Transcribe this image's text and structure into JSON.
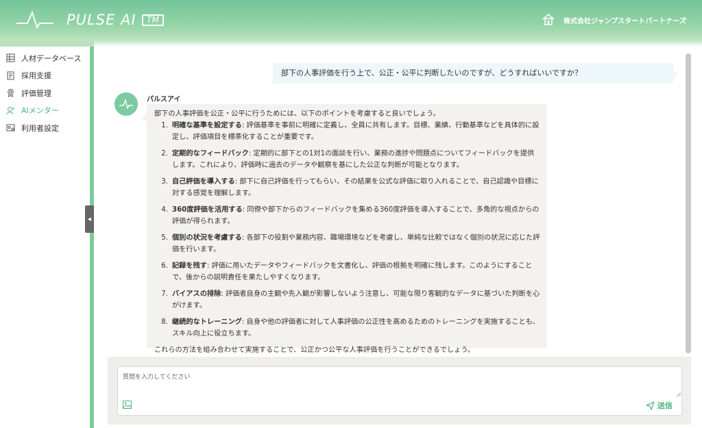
{
  "header": {
    "brand": "PULSE AI",
    "tm": "TM",
    "company": "株式会社ジャンプスタートパートナーズ",
    "chevron": "⌄"
  },
  "sidebar": {
    "items": [
      {
        "label": "人材データベース",
        "icon": "database-icon"
      },
      {
        "label": "採用支援",
        "icon": "document-icon"
      },
      {
        "label": "評価管理",
        "icon": "award-icon"
      },
      {
        "label": "AIメンター",
        "icon": "mentor-icon",
        "active": true
      },
      {
        "label": "利用者設定",
        "icon": "user-settings-icon"
      }
    ],
    "collapse_label": "◀"
  },
  "chat": {
    "user_message": "部下の人事評価を行う上で、公正・公平に判断したいのですが、どうすればいいですか？",
    "bot_name": "パルスアイ",
    "bot_intro": "部下の人事評価を公正・公平に行うためには、以下のポイントを考慮すると良いでしょう。",
    "points": [
      {
        "num": "1.",
        "title": "明確な基準を設定する",
        "text": ": 評価基準を事前に明確に定義し、全員に共有します。目標、業績、行動基準などを具体的に設定し、評価項目を標準化することが重要です。"
      },
      {
        "num": "2.",
        "title": "定期的なフィードバック",
        "text": ": 定期的に部下との1対1の面談を行い、業務の進捗や問題点についてフィードバックを提供します。これにより、評価時に過去のデータや観察を基にした公正な判断が可能となります。"
      },
      {
        "num": "3.",
        "title": "自己評価を導入する",
        "text": ": 部下に自己評価を行ってもらい、その結果を公式な評価に取り入れることで、自己認識や目標に対する感覚を理解します。"
      },
      {
        "num": "4.",
        "title": "360度評価を活用する",
        "text": ": 同僚や部下からのフィードバックを集める360度評価を導入することで、多角的な視点からの評価が得られます。"
      },
      {
        "num": "5.",
        "title": "個別の状況を考慮する",
        "text": ": 各部下の役割や業務内容、職場環境などを考慮し、単純な比較ではなく個別の状況に応じた評価を行います。"
      },
      {
        "num": "6.",
        "title": "記録を残す",
        "text": ": 評価に用いたデータやフィードバックを文書化し、評価の根拠を明確に残します。このようにすることで、後からの説明責任を果たしやすくなります。"
      },
      {
        "num": "7.",
        "title": "バイアスの排除",
        "text": ": 評価者自身の主観や先入観が影響しないよう注意し、可能な限り客観的なデータに基づいた判断を心がけます。"
      },
      {
        "num": "8.",
        "title": "継続的なトレーニング",
        "text": ": 自身や他の評価者に対して人事評価の公正性を高めるためのトレーニングを実施することも、スキル向上に役立ちます。"
      }
    ],
    "bot_outro": "これらの方法を組み合わせて実施することで、公正かつ公平な人事評価を行うことができるでしょう。"
  },
  "input": {
    "placeholder": "質問を入力してください",
    "send_label": "送信"
  },
  "colors": {
    "accent": "#4db27c",
    "header_green": "#74c59a",
    "bubble_user": "#eef7fa",
    "bubble_bot": "#f3f2ef"
  }
}
